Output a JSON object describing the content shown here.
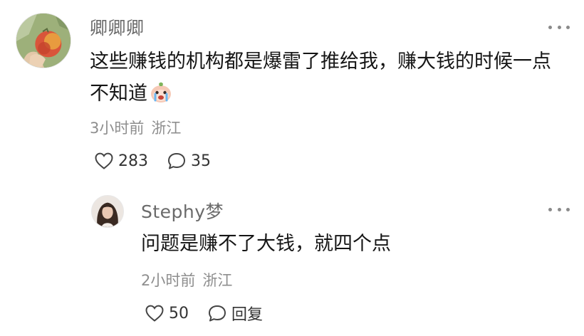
{
  "main_comment": {
    "username": "卿卿卿",
    "text_line1": "这些赚钱的机构都是爆雷了推给我，赚大钱的时候一点",
    "text_line2": "不知道",
    "emoji": "crying-face-emoji",
    "time": "3小时前",
    "location": "浙江",
    "likes": "283",
    "comments": "35"
  },
  "reply": {
    "username": "Stephy梦",
    "text": "问题是赚不了大钱，就四个点",
    "time": "2小时前",
    "location": "浙江",
    "likes": "50",
    "reply_label": "回复"
  },
  "icons": {
    "like": "heart-icon",
    "comment": "comment-bubble-icon",
    "more": "more-dots-icon"
  },
  "colors": {
    "text": "#151515",
    "username": "#6a6a6a",
    "meta": "#8e8e8e"
  }
}
